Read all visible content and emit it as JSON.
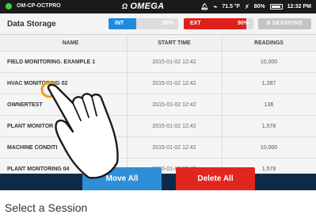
{
  "status_bar": {
    "device_name": "OM-CP-OCTPRO",
    "brand": "OMEGA",
    "brand_mark": "Ω",
    "temperature": "71.5 °F",
    "battery": "80%",
    "time": "12:32 PM"
  },
  "header": {
    "title": "Data Storage",
    "internal": {
      "label": "INT",
      "percent_text": "60%",
      "fill_fraction": 0.4
    },
    "external": {
      "label": "EXT",
      "percent_text": "90%",
      "fill_fraction": 0.9
    },
    "sessions_button": "8 SESSIONS"
  },
  "table": {
    "columns": [
      "NAME",
      "START TIME",
      "READINGS"
    ],
    "rows": [
      {
        "name": "FIELD MONITORING. EXAMPLE 1",
        "start": "2015-01-02 12:42",
        "readings": "10,000"
      },
      {
        "name": "HVAC MONITORING 02",
        "start": "2015-01-02 12:42",
        "readings": "1,287"
      },
      {
        "name": "OWNERTEST",
        "start": "2015-01-02 12:42",
        "readings": "136"
      },
      {
        "name": "PLANT MONITOR",
        "start": "2015-01-02 12:42",
        "readings": "1,578"
      },
      {
        "name": "MACHINE CONDITI",
        "start": "2015-01-02 12:42",
        "readings": "10,000"
      },
      {
        "name": "PLANT MONTORING 04",
        "start": "2015-01-02 12:42",
        "readings": "1,578"
      }
    ]
  },
  "actions": {
    "move_all": "Move All",
    "delete_all": "Delete All"
  },
  "caption": "Select a Session",
  "colors": {
    "internal": "#1f8be0",
    "external": "#e1261f",
    "move_button": "#2e8fd8",
    "delete_button": "#e1261f",
    "bottom_bar": "#0f2a47"
  }
}
